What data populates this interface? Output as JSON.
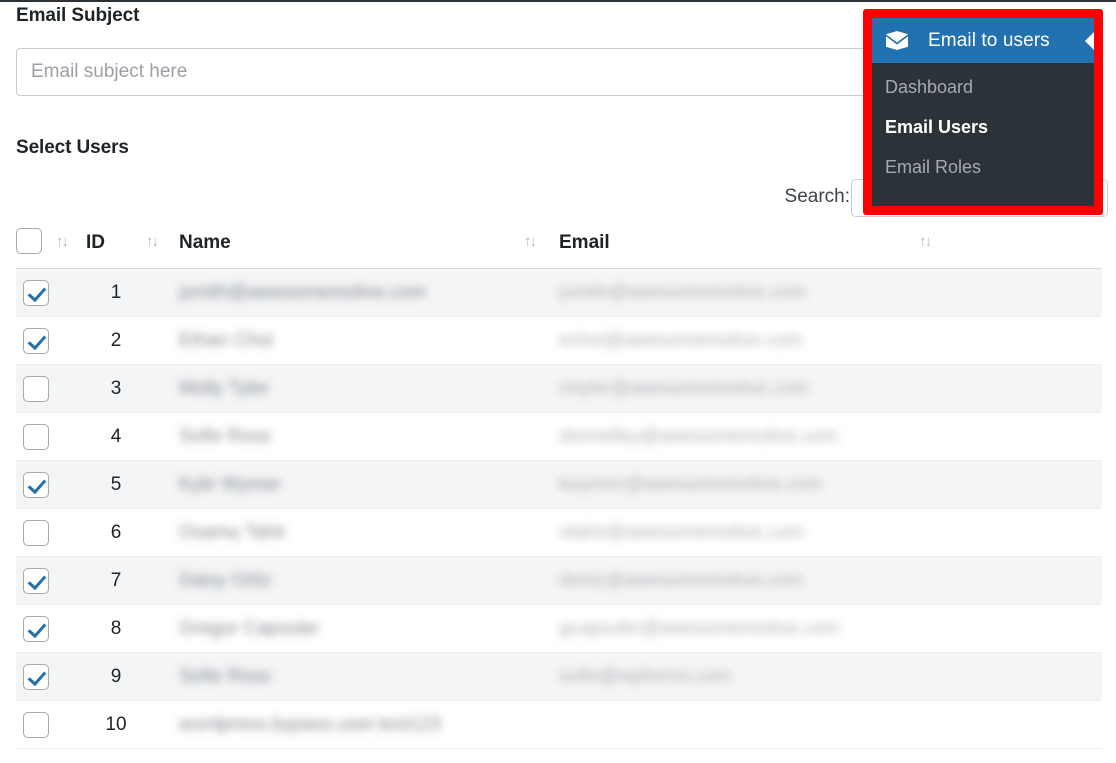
{
  "form": {
    "subject_label": "Email Subject",
    "subject_value": "",
    "subject_placeholder": "Email subject here",
    "select_users_label": "Select Users"
  },
  "search": {
    "label": "Search:",
    "value": "",
    "placeholder": ""
  },
  "table": {
    "sort_icon": "↑↓",
    "columns": [
      {
        "key": "checkbox",
        "label": ""
      },
      {
        "key": "id",
        "label": "ID"
      },
      {
        "key": "name",
        "label": "Name"
      },
      {
        "key": "email",
        "label": "Email"
      }
    ],
    "header_select_all_checked": false,
    "rows": [
      {
        "id": "1",
        "checked": true,
        "name": "jsmith@awesomemotive.com",
        "email": "jsmith@awesomemotive.com"
      },
      {
        "id": "2",
        "checked": true,
        "name": "Ethan Choi",
        "email": "echoi@awesomemotive.com"
      },
      {
        "id": "3",
        "checked": false,
        "name": "Molly Tyler",
        "email": "mtyler@awesomemotive.com"
      },
      {
        "id": "4",
        "checked": false,
        "name": "Sofie Ross",
        "email": "donnelley@awesomemotive.com"
      },
      {
        "id": "5",
        "checked": true,
        "name": "Kyle Wymer",
        "email": "kwymer@awesomemotive.com"
      },
      {
        "id": "6",
        "checked": false,
        "name": "Osamu Tahir",
        "email": "otahir@awesomemotive.com"
      },
      {
        "id": "7",
        "checked": true,
        "name": "Daisy Ortiz",
        "email": "dortiz@awesomemotive.com"
      },
      {
        "id": "8",
        "checked": true,
        "name": "Gregor Capsuler",
        "email": "gcapsuler@awesomemotive.com"
      },
      {
        "id": "9",
        "checked": true,
        "name": "Sofie Ross",
        "email": "sofie@wpforms.com"
      },
      {
        "id": "10",
        "checked": false,
        "name": "wordpress.bypass.user.test123",
        "email": ""
      }
    ]
  },
  "menu": {
    "icon": "envelope-icon",
    "title": "Email to users",
    "arrow": "caret-left-icon",
    "highlight_color": "#ff0000",
    "header_color": "#2271b1",
    "panel_color": "#2c3338",
    "items": [
      {
        "label": "Dashboard",
        "current": false
      },
      {
        "label": "Email Users",
        "current": true
      },
      {
        "label": "Email Roles",
        "current": false
      }
    ]
  }
}
